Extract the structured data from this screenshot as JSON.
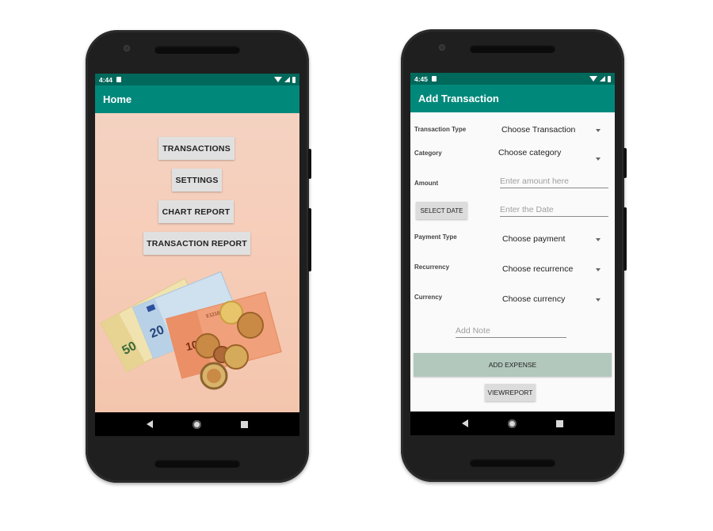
{
  "colors": {
    "status_bar": "#00695c",
    "app_bar": "#00897b",
    "add_expense_button": "#b2c8bd"
  },
  "home": {
    "status_time": "4:44",
    "title": "Home",
    "buttons": [
      "TRANSACTIONS",
      "SETTINGS",
      "CHART REPORT",
      "TRANSACTION REPORT"
    ]
  },
  "add_transaction": {
    "status_time": "4:45",
    "title": "Add Transaction",
    "transaction_type": {
      "label": "Transaction Type",
      "value": "Choose Transaction"
    },
    "category": {
      "label": "Category",
      "value": "Choose category"
    },
    "amount": {
      "label": "Amount",
      "placeholder": "Enter amount here"
    },
    "date": {
      "button": "SELECT DATE",
      "placeholder": "Enter the Date"
    },
    "payment_type": {
      "label": "Payment Type",
      "value": "Choose payment"
    },
    "recurrency": {
      "label": "Recurrency",
      "value": "Choose recurrence"
    },
    "currency": {
      "label": "Currency",
      "value": "Choose currency"
    },
    "note": {
      "placeholder": "Add Note"
    },
    "add_expense_button": "ADD EXPENSE",
    "view_report_button": "VIEWREPORT"
  }
}
